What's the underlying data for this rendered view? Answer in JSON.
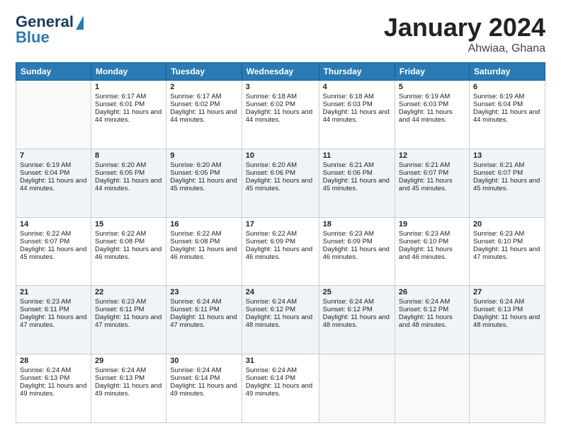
{
  "logo": {
    "line1": "General",
    "line2": "Blue"
  },
  "header": {
    "month": "January 2024",
    "location": "Ahwiaa, Ghana"
  },
  "columns": [
    "Sunday",
    "Monday",
    "Tuesday",
    "Wednesday",
    "Thursday",
    "Friday",
    "Saturday"
  ],
  "weeks": [
    [
      {
        "day": "",
        "sunrise": "",
        "sunset": "",
        "daylight": ""
      },
      {
        "day": "1",
        "sunrise": "Sunrise: 6:17 AM",
        "sunset": "Sunset: 6:01 PM",
        "daylight": "Daylight: 11 hours and 44 minutes."
      },
      {
        "day": "2",
        "sunrise": "Sunrise: 6:17 AM",
        "sunset": "Sunset: 6:02 PM",
        "daylight": "Daylight: 11 hours and 44 minutes."
      },
      {
        "day": "3",
        "sunrise": "Sunrise: 6:18 AM",
        "sunset": "Sunset: 6:02 PM",
        "daylight": "Daylight: 11 hours and 44 minutes."
      },
      {
        "day": "4",
        "sunrise": "Sunrise: 6:18 AM",
        "sunset": "Sunset: 6:03 PM",
        "daylight": "Daylight: 11 hours and 44 minutes."
      },
      {
        "day": "5",
        "sunrise": "Sunrise: 6:19 AM",
        "sunset": "Sunset: 6:03 PM",
        "daylight": "Daylight: 11 hours and 44 minutes."
      },
      {
        "day": "6",
        "sunrise": "Sunrise: 6:19 AM",
        "sunset": "Sunset: 6:04 PM",
        "daylight": "Daylight: 11 hours and 44 minutes."
      }
    ],
    [
      {
        "day": "7",
        "sunrise": "Sunrise: 6:19 AM",
        "sunset": "Sunset: 6:04 PM",
        "daylight": "Daylight: 11 hours and 44 minutes."
      },
      {
        "day": "8",
        "sunrise": "Sunrise: 6:20 AM",
        "sunset": "Sunset: 6:05 PM",
        "daylight": "Daylight: 11 hours and 44 minutes."
      },
      {
        "day": "9",
        "sunrise": "Sunrise: 6:20 AM",
        "sunset": "Sunset: 6:05 PM",
        "daylight": "Daylight: 11 hours and 45 minutes."
      },
      {
        "day": "10",
        "sunrise": "Sunrise: 6:20 AM",
        "sunset": "Sunset: 6:06 PM",
        "daylight": "Daylight: 11 hours and 45 minutes."
      },
      {
        "day": "11",
        "sunrise": "Sunrise: 6:21 AM",
        "sunset": "Sunset: 6:06 PM",
        "daylight": "Daylight: 11 hours and 45 minutes."
      },
      {
        "day": "12",
        "sunrise": "Sunrise: 6:21 AM",
        "sunset": "Sunset: 6:07 PM",
        "daylight": "Daylight: 11 hours and 45 minutes."
      },
      {
        "day": "13",
        "sunrise": "Sunrise: 6:21 AM",
        "sunset": "Sunset: 6:07 PM",
        "daylight": "Daylight: 11 hours and 45 minutes."
      }
    ],
    [
      {
        "day": "14",
        "sunrise": "Sunrise: 6:22 AM",
        "sunset": "Sunset: 6:07 PM",
        "daylight": "Daylight: 11 hours and 45 minutes."
      },
      {
        "day": "15",
        "sunrise": "Sunrise: 6:22 AM",
        "sunset": "Sunset: 6:08 PM",
        "daylight": "Daylight: 11 hours and 46 minutes."
      },
      {
        "day": "16",
        "sunrise": "Sunrise: 6:22 AM",
        "sunset": "Sunset: 6:08 PM",
        "daylight": "Daylight: 11 hours and 46 minutes."
      },
      {
        "day": "17",
        "sunrise": "Sunrise: 6:22 AM",
        "sunset": "Sunset: 6:09 PM",
        "daylight": "Daylight: 11 hours and 46 minutes."
      },
      {
        "day": "18",
        "sunrise": "Sunrise: 6:23 AM",
        "sunset": "Sunset: 6:09 PM",
        "daylight": "Daylight: 11 hours and 46 minutes."
      },
      {
        "day": "19",
        "sunrise": "Sunrise: 6:23 AM",
        "sunset": "Sunset: 6:10 PM",
        "daylight": "Daylight: 11 hours and 46 minutes."
      },
      {
        "day": "20",
        "sunrise": "Sunrise: 6:23 AM",
        "sunset": "Sunset: 6:10 PM",
        "daylight": "Daylight: 11 hours and 47 minutes."
      }
    ],
    [
      {
        "day": "21",
        "sunrise": "Sunrise: 6:23 AM",
        "sunset": "Sunset: 6:11 PM",
        "daylight": "Daylight: 11 hours and 47 minutes."
      },
      {
        "day": "22",
        "sunrise": "Sunrise: 6:23 AM",
        "sunset": "Sunset: 6:11 PM",
        "daylight": "Daylight: 11 hours and 47 minutes."
      },
      {
        "day": "23",
        "sunrise": "Sunrise: 6:24 AM",
        "sunset": "Sunset: 6:11 PM",
        "daylight": "Daylight: 11 hours and 47 minutes."
      },
      {
        "day": "24",
        "sunrise": "Sunrise: 6:24 AM",
        "sunset": "Sunset: 6:12 PM",
        "daylight": "Daylight: 11 hours and 48 minutes."
      },
      {
        "day": "25",
        "sunrise": "Sunrise: 6:24 AM",
        "sunset": "Sunset: 6:12 PM",
        "daylight": "Daylight: 11 hours and 48 minutes."
      },
      {
        "day": "26",
        "sunrise": "Sunrise: 6:24 AM",
        "sunset": "Sunset: 6:12 PM",
        "daylight": "Daylight: 11 hours and 48 minutes."
      },
      {
        "day": "27",
        "sunrise": "Sunrise: 6:24 AM",
        "sunset": "Sunset: 6:13 PM",
        "daylight": "Daylight: 11 hours and 48 minutes."
      }
    ],
    [
      {
        "day": "28",
        "sunrise": "Sunrise: 6:24 AM",
        "sunset": "Sunset: 6:13 PM",
        "daylight": "Daylight: 11 hours and 49 minutes."
      },
      {
        "day": "29",
        "sunrise": "Sunrise: 6:24 AM",
        "sunset": "Sunset: 6:13 PM",
        "daylight": "Daylight: 11 hours and 49 minutes."
      },
      {
        "day": "30",
        "sunrise": "Sunrise: 6:24 AM",
        "sunset": "Sunset: 6:14 PM",
        "daylight": "Daylight: 11 hours and 49 minutes."
      },
      {
        "day": "31",
        "sunrise": "Sunrise: 6:24 AM",
        "sunset": "Sunset: 6:14 PM",
        "daylight": "Daylight: 11 hours and 49 minutes."
      },
      {
        "day": "",
        "sunrise": "",
        "sunset": "",
        "daylight": ""
      },
      {
        "day": "",
        "sunrise": "",
        "sunset": "",
        "daylight": ""
      },
      {
        "day": "",
        "sunrise": "",
        "sunset": "",
        "daylight": ""
      }
    ]
  ]
}
